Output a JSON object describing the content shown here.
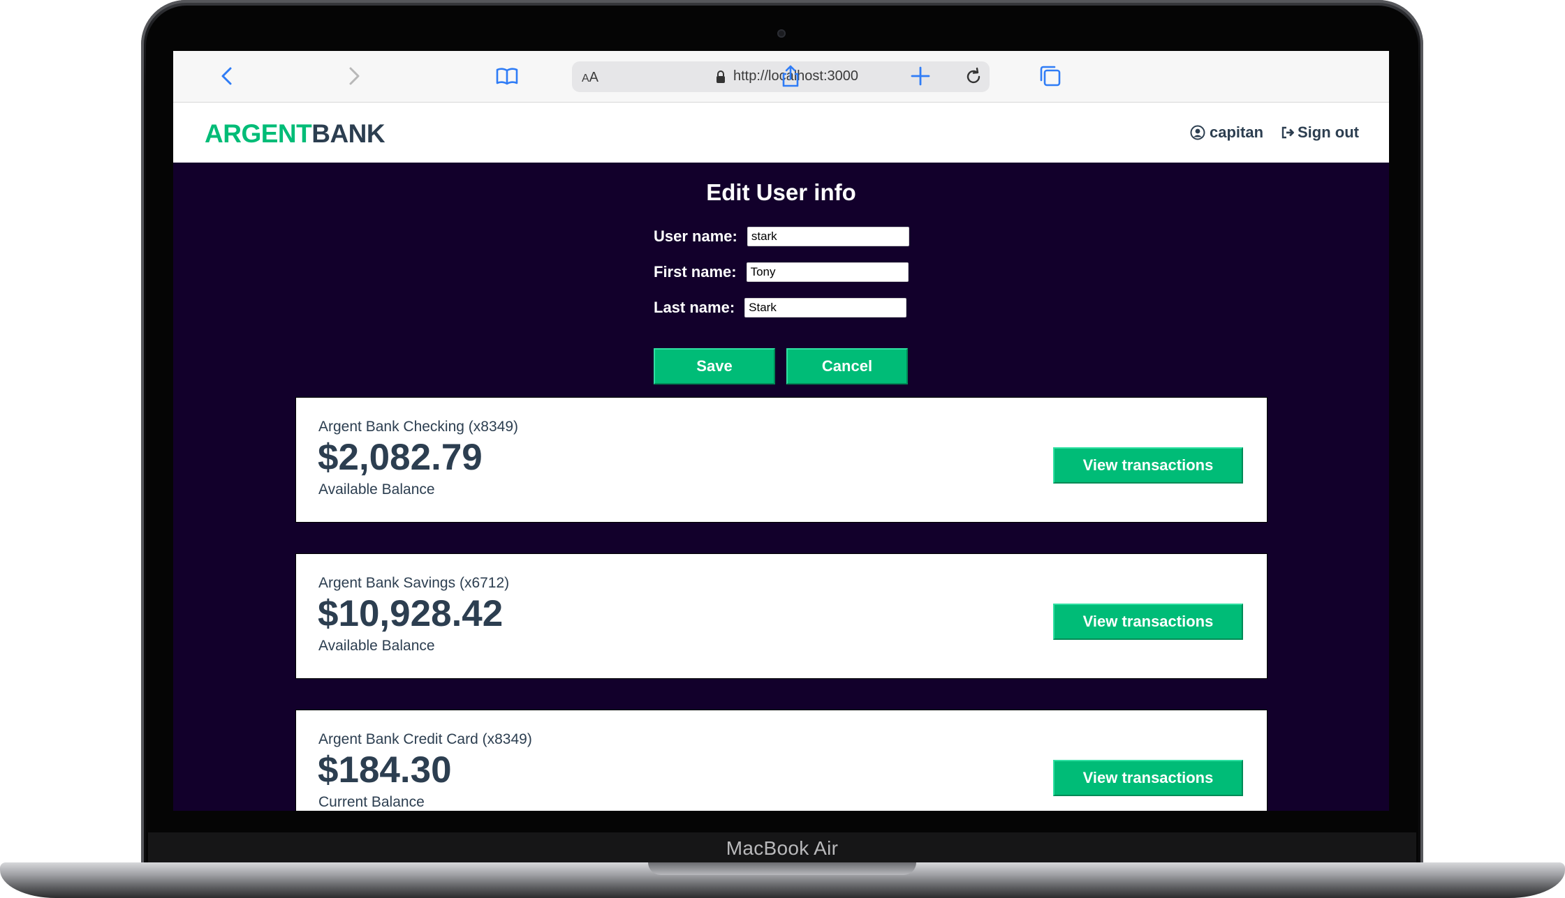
{
  "device": {
    "label": "MacBook Air"
  },
  "browser": {
    "text_size_label": "AA",
    "url": "http://localhost:3000",
    "icons": [
      "back-arrow-icon",
      "forward-arrow-icon",
      "bookmarks-icon",
      "lock-icon",
      "reload-icon",
      "share-icon",
      "new-tab-icon",
      "tabs-icon"
    ]
  },
  "header": {
    "logo_part1": "ARGENT",
    "logo_part2": "BANK",
    "user_name": "capitan",
    "sign_out": "Sign out"
  },
  "edit_form": {
    "title": "Edit User info",
    "fields": [
      {
        "label": "User name:",
        "value": "stark"
      },
      {
        "label": "First name:",
        "value": "Tony"
      },
      {
        "label": "Last name:",
        "value": "Stark"
      }
    ],
    "save_label": "Save",
    "cancel_label": "Cancel"
  },
  "accounts": [
    {
      "title": "Argent Bank Checking (x8349)",
      "amount": "$2,082.79",
      "description": "Available Balance",
      "button": "View transactions"
    },
    {
      "title": "Argent Bank Savings (x6712)",
      "amount": "$10,928.42",
      "description": "Available Balance",
      "button": "View transactions"
    },
    {
      "title": "Argent Bank Credit Card (x8349)",
      "amount": "$184.30",
      "description": "Current Balance",
      "button": "View transactions"
    }
  ],
  "colors": {
    "brand_green": "#00bc77",
    "page_background": "#12002b",
    "text_dark": "#2c3e50"
  }
}
